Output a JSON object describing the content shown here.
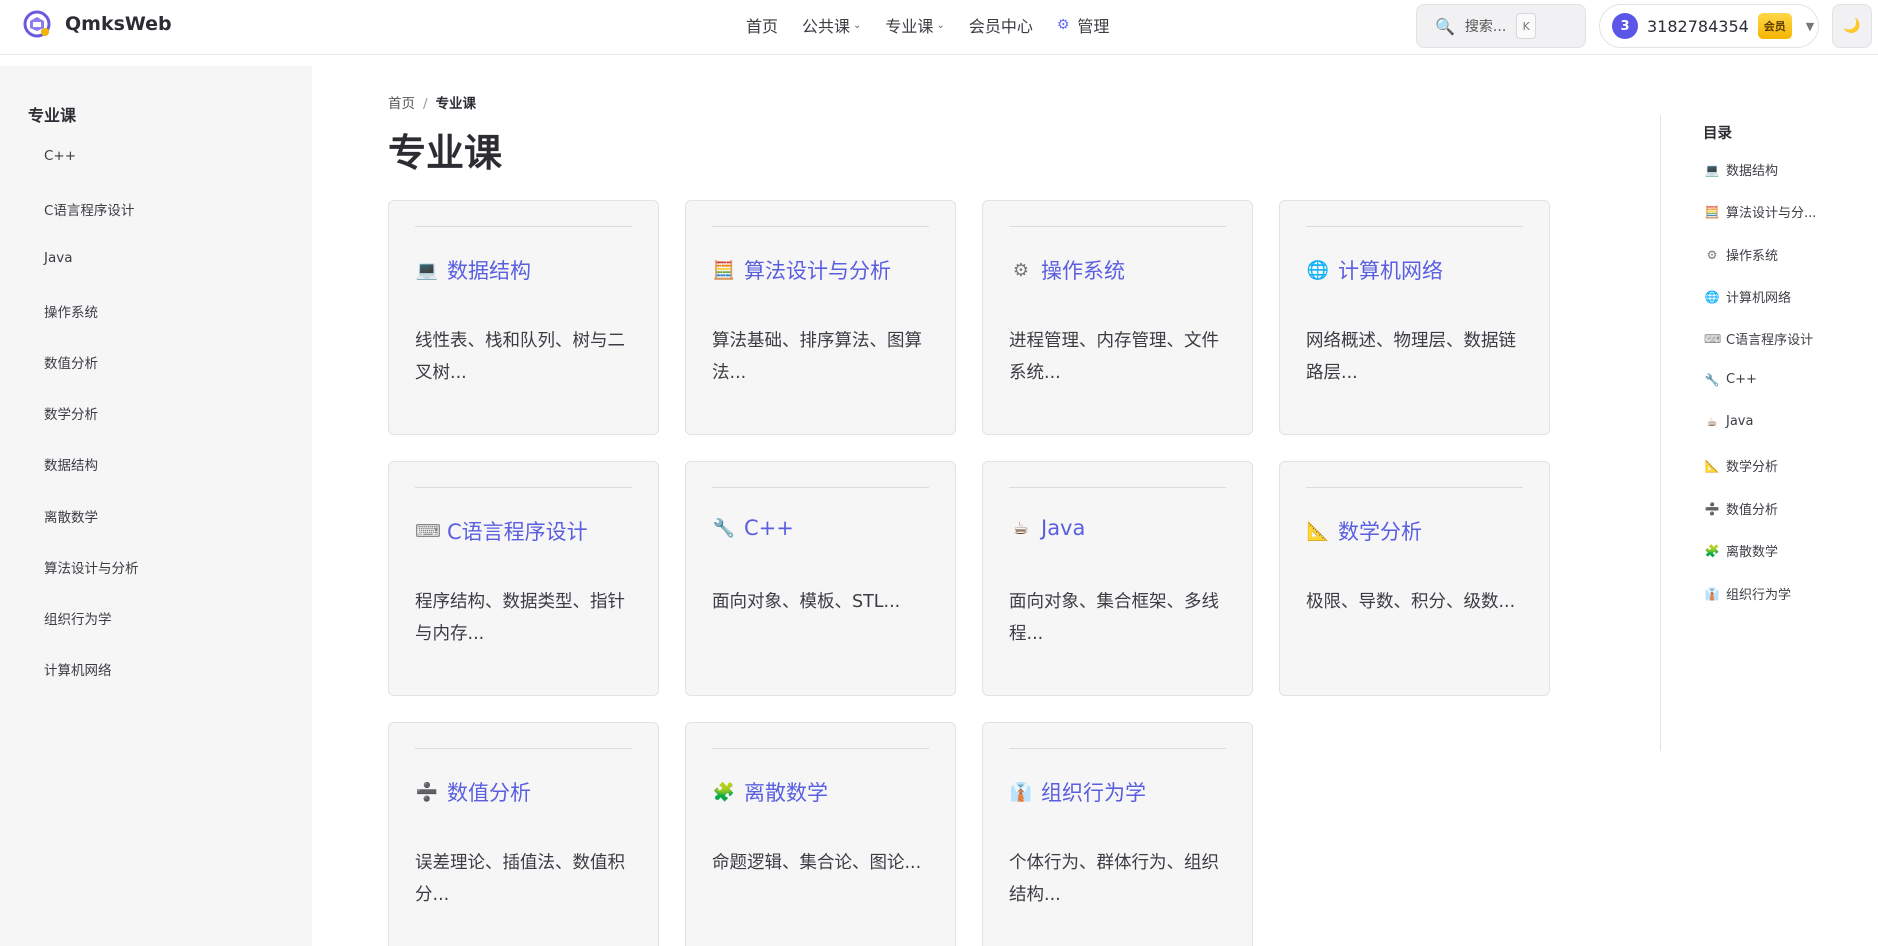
{
  "header": {
    "site_title": "QmksWeb",
    "nav": [
      {
        "label": "首页",
        "has_dropdown": false
      },
      {
        "label": "公共课",
        "has_dropdown": true
      },
      {
        "label": "专业课",
        "has_dropdown": true
      },
      {
        "label": "会员中心",
        "has_dropdown": false
      },
      {
        "label": "管理",
        "has_dropdown": false,
        "icon": "gear-icon"
      }
    ],
    "search": {
      "label": "搜索...",
      "shortcut": "K"
    },
    "user": {
      "avatar_text": "3",
      "name": "3182784354",
      "badge": "会员"
    },
    "theme_toggle_icon": "moon-icon"
  },
  "sidebar": {
    "title": "专业课",
    "items": [
      "C++",
      "C语言程序设计",
      "Java",
      "操作系统",
      "数值分析",
      "数学分析",
      "数据结构",
      "离散数学",
      "算法设计与分析",
      "组织行为学",
      "计算机网络"
    ]
  },
  "breadcrumb": {
    "home": "首页",
    "separator": "/",
    "current": "专业课"
  },
  "page_title": "专业课",
  "cards": [
    {
      "icon": "💻",
      "icon_name": "laptop-icon",
      "title": "数据结构",
      "desc": "线性表、栈和队列、树与二叉树..."
    },
    {
      "icon": "🧮",
      "icon_name": "abacus-icon",
      "title": "算法设计与分析",
      "desc": "算法基础、排序算法、图算法..."
    },
    {
      "icon": "⚙",
      "icon_name": "gear-icon",
      "title": "操作系统",
      "desc": "进程管理、内存管理、文件系统..."
    },
    {
      "icon": "🌐",
      "icon_name": "globe-icon",
      "title": "计算机网络",
      "desc": "网络概述、物理层、数据链路层..."
    },
    {
      "icon": "⌨",
      "icon_name": "keyboard-icon",
      "title": "C语言程序设计",
      "desc": "程序结构、数据类型、指针与内存..."
    },
    {
      "icon": "🔧",
      "icon_name": "wrench-icon",
      "title": "C++",
      "desc": "面向对象、模板、STL..."
    },
    {
      "icon": "☕",
      "icon_name": "coffee-icon",
      "title": "Java",
      "desc": "面向对象、集合框架、多线程..."
    },
    {
      "icon": "📐",
      "icon_name": "triangle-ruler-icon",
      "title": "数学分析",
      "desc": "极限、导数、积分、级数..."
    },
    {
      "icon": "➗",
      "icon_name": "divide-icon",
      "title": "数值分析",
      "desc": "误差理论、插值法、数值积分..."
    },
    {
      "icon": "🧩",
      "icon_name": "puzzle-icon",
      "title": "离散数学",
      "desc": "命题逻辑、集合论、图论..."
    },
    {
      "icon": "👔",
      "icon_name": "necktie-icon",
      "title": "组织行为学",
      "desc": "个体行为、群体行为、组织结构..."
    }
  ],
  "toc": {
    "title": "目录",
    "items": [
      {
        "icon": "💻",
        "icon_name": "laptop-icon",
        "label": "数据结构"
      },
      {
        "icon": "🧮",
        "icon_name": "abacus-icon",
        "label": "算法设计与分..."
      },
      {
        "icon": "⚙",
        "icon_name": "gear-icon",
        "label": "操作系统"
      },
      {
        "icon": "🌐",
        "icon_name": "globe-icon",
        "label": "计算机网络"
      },
      {
        "icon": "⌨",
        "icon_name": "keyboard-icon",
        "label": "C语言程序设计"
      },
      {
        "icon": "🔧",
        "icon_name": "wrench-icon",
        "label": "C++"
      },
      {
        "icon": "☕",
        "icon_name": "coffee-icon",
        "label": "Java"
      },
      {
        "icon": "📐",
        "icon_name": "triangle-ruler-icon",
        "label": "数学分析"
      },
      {
        "icon": "➗",
        "icon_name": "divide-icon",
        "label": "数值分析"
      },
      {
        "icon": "🧩",
        "icon_name": "puzzle-icon",
        "label": "离散数学"
      },
      {
        "icon": "👔",
        "icon_name": "necktie-icon",
        "label": "组织行为学"
      }
    ]
  }
}
